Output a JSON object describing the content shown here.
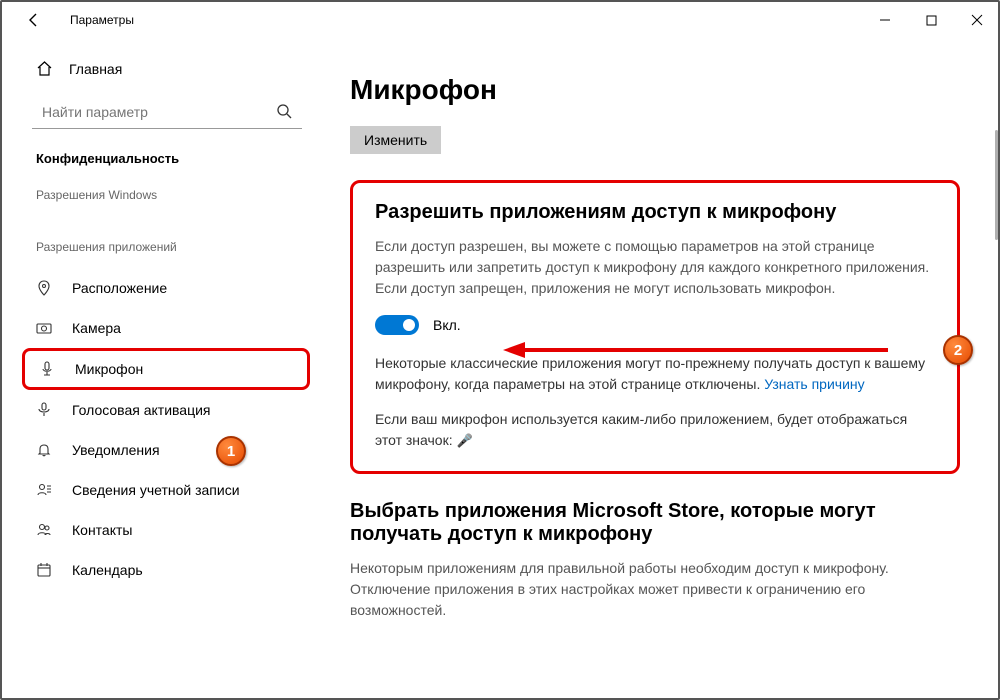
{
  "titlebar": {
    "title": "Параметры"
  },
  "sidebar": {
    "home": "Главная",
    "search_placeholder": "Найти параметр",
    "section": "Конфиденциальность",
    "group_windows": "Разрешения Windows",
    "group_apps": "Разрешения приложений",
    "items": {
      "location": "Расположение",
      "camera": "Камера",
      "microphone": "Микрофон",
      "voice": "Голосовая активация",
      "notifications": "Уведомления",
      "account": "Сведения учетной записи",
      "contacts": "Контакты",
      "calendar": "Календарь"
    }
  },
  "main": {
    "title": "Микрофон",
    "change_btn": "Изменить",
    "allow_title": "Разрешить приложениям доступ к микрофону",
    "allow_desc": "Если доступ разрешен, вы можете с помощью параметров на этой странице разрешить или запретить доступ к микрофону для каждого конкретного приложения. Если доступ запрещен, приложения не могут использовать микрофон.",
    "toggle_label": "Вкл.",
    "classic_desc": "Некоторые классические приложения могут по-прежнему получать доступ к вашему микрофону, когда параметры на этой странице отключены. ",
    "learn_why": "Узнать причину",
    "in_use_desc": "Если ваш микрофон используется каким-либо приложением, будет отображаться этот значок: ",
    "store_title": "Выбрать приложения Microsoft Store, которые могут получать доступ к микрофону",
    "store_desc": "Некоторым приложениям для правильной работы необходим доступ к микрофону. Отключение приложения в этих настройках может привести к ограничению его возможностей."
  },
  "badges": {
    "one": "1",
    "two": "2"
  }
}
